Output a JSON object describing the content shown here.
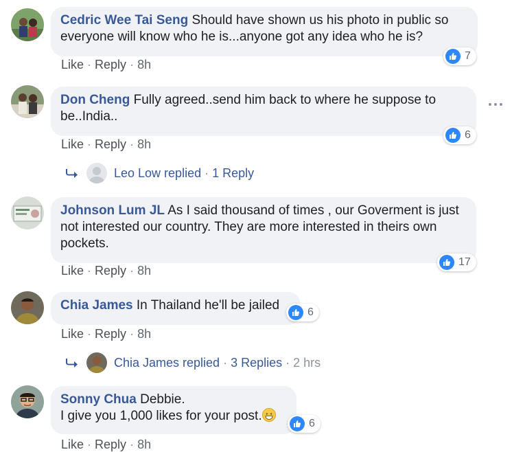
{
  "actions": {
    "like": "Like",
    "reply": "Reply"
  },
  "comments": [
    {
      "author": "Cedric Wee Tai Seng",
      "text": "Should have shown us his photo in public so everyone will know who he is...anyone got any idea who he is?",
      "time": "8h",
      "likes": "7"
    },
    {
      "author": "Don Cheng",
      "text": "Fully agreed..send him back to where he suppose to be..India..",
      "time": "8h",
      "likes": "6",
      "replies": {
        "name": "Leo Low replied",
        "count": "1 Reply",
        "time": ""
      }
    },
    {
      "author": "Johnson Lum JL",
      "text": "As I said thousand of times , our Goverment is just not interested our country. They are more interested in theirs own pockets.",
      "time": "8h",
      "likes": "17"
    },
    {
      "author": "Chia James",
      "text": "In Thailand he'll be jailed",
      "time": "8h",
      "likes": "6",
      "replies": {
        "name": "Chia James replied",
        "count": "3 Replies",
        "time": "2 hrs"
      }
    },
    {
      "author": "Sonny Chua",
      "text": "Debbie.",
      "text2": "I give you 1,000 likes for your post.",
      "time": "8h",
      "likes": "6"
    }
  ],
  "colors": {
    "author": "#385898",
    "bubble": "#f0f2f5",
    "like": "#2d88ff"
  }
}
